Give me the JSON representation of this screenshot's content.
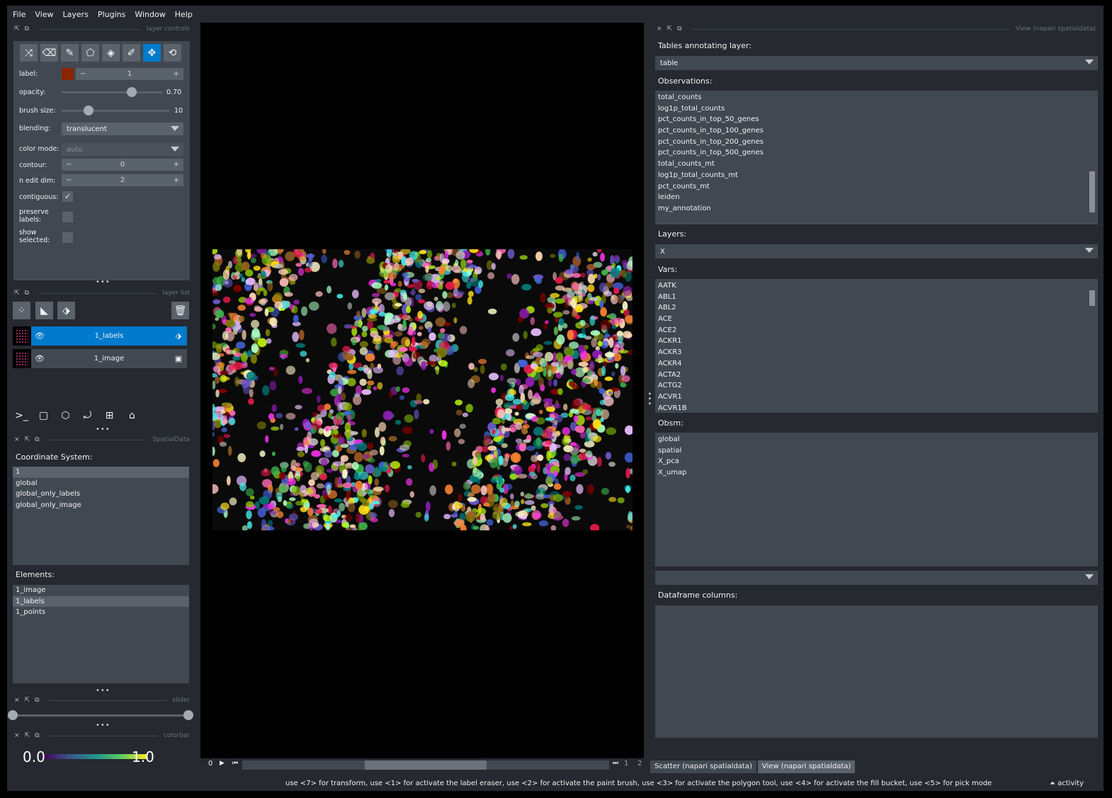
{
  "menu": [
    "File",
    "View",
    "Layers",
    "Plugins",
    "Window",
    "Help"
  ],
  "layer_controls": {
    "title": "layer controls",
    "tools": [
      "shuffle-icon",
      "eraser-icon",
      "brush-icon",
      "polygon-icon",
      "fill-icon",
      "picker-icon",
      "move-icon",
      "transform-icon"
    ],
    "label_text": "label:",
    "label_value": "1",
    "label_color": "#8b2500",
    "opacity_text": "opacity:",
    "opacity_value": "0.70",
    "opacity_level": 0.7,
    "brush_text": "brush size:",
    "brush_value": "10",
    "brush_level": 0.25,
    "blending_text": "blending:",
    "blending_value": "translucent",
    "colormode_text": "color mode:",
    "colormode_value": "auto",
    "contour_text": "contour:",
    "contour_value": "0",
    "nedit_text": "n edit dim:",
    "nedit_value": "2",
    "contiguous_text": "contiguous:",
    "preserve_text": "preserve labels:",
    "show_selected_text": "show selected:"
  },
  "layer_list": {
    "title": "layer list",
    "layers": [
      {
        "name": "1_labels",
        "selected": true
      },
      {
        "name": "1_image",
        "selected": false
      }
    ]
  },
  "spatialdata": {
    "title": "SpatialData",
    "coord_heading": "Coordinate System:",
    "coords": [
      "1",
      "global",
      "global_only_labels",
      "global_only_image"
    ],
    "elements_heading": "Elements:",
    "elements": [
      "1_image",
      "1_labels",
      "1_points"
    ]
  },
  "slider": {
    "title": "slider"
  },
  "colorbar": {
    "title": "colorbar",
    "min": "0.0",
    "max": "1.0"
  },
  "dims": {
    "start": "0",
    "cur": "1",
    "total": "2"
  },
  "view": {
    "title": "View (napari spatialdata)",
    "tables_heading": "Tables annotating layer:",
    "table_value": "table",
    "obs_heading": "Observations:",
    "observations": [
      "total_counts",
      "log1p_total_counts",
      "pct_counts_in_top_50_genes",
      "pct_counts_in_top_100_genes",
      "pct_counts_in_top_200_genes",
      "pct_counts_in_top_500_genes",
      "total_counts_mt",
      "log1p_total_counts_mt",
      "pct_counts_mt",
      "leiden",
      "my_annotation"
    ],
    "layers_heading": "Layers:",
    "layers_value": "X",
    "vars_heading": "Vars:",
    "vars": [
      "AATK",
      "ABL1",
      "ABL2",
      "ACE",
      "ACE2",
      "ACKR1",
      "ACKR3",
      "ACKR4",
      "ACTA2",
      "ACTG2",
      "ACVR1",
      "ACVR1B"
    ],
    "obsm_heading": "Obsm:",
    "obsm": [
      "global",
      "spatial",
      "X_pca",
      "X_umap"
    ],
    "df_heading": "Dataframe columns:"
  },
  "tabs": [
    "Scatter (napari spatialdata)",
    "View (napari spatialdata)"
  ],
  "status": {
    "message": "use <7> for transform, use <1> for activate the label eraser, use <2> for activate the paint brush, use <3> for activate the polygon tool, use <4> for activate the fill bucket, use <5> for pick mode",
    "activity": "activity"
  }
}
